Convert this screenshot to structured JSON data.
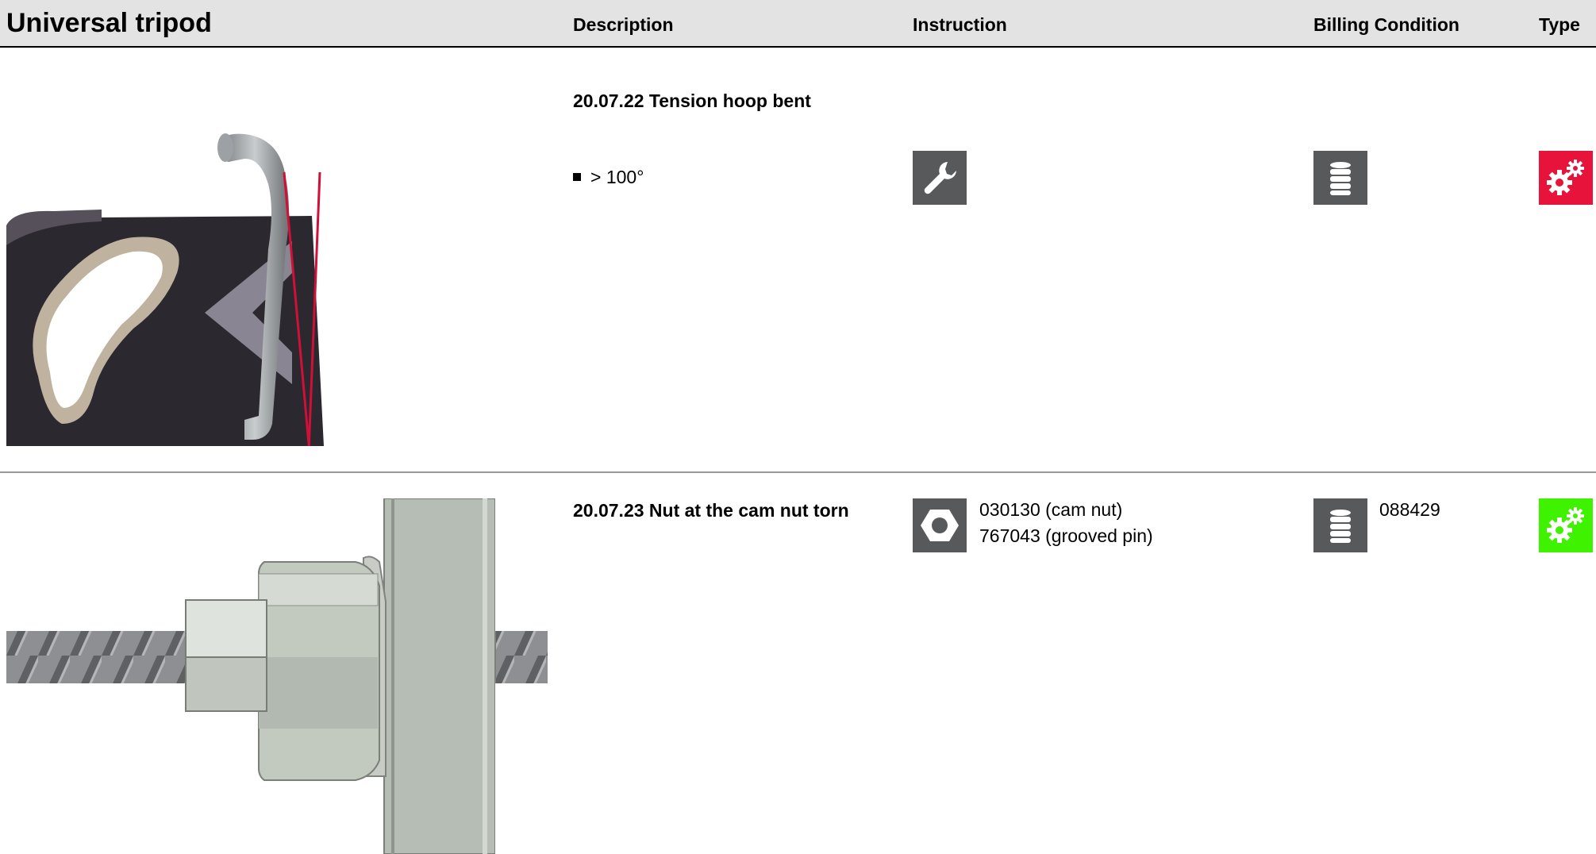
{
  "header": {
    "title": "Universal tripod",
    "col_description": "Description",
    "col_instruction": "Instruction",
    "col_billing": "Billing Condition",
    "col_type": "Type"
  },
  "rows": [
    {
      "title": "20.07.22 Tension hoop bent",
      "bullet": "> 100°",
      "instruction_icon": "wrench-icon",
      "billing_icon": "coin-stack-icon",
      "type_icon": "gears-icon",
      "type_color": "#e8133b"
    },
    {
      "title": "20.07.23 Nut at the cam nut torn",
      "instruction_icon": "nut-icon",
      "instruction_lines": [
        "030130 (cam nut)",
        "767043 (grooved pin)"
      ],
      "billing_icon": "coin-stack-icon",
      "billing_text": "088429",
      "type_icon": "gears-icon",
      "type_color": "#3ff200"
    }
  ]
}
